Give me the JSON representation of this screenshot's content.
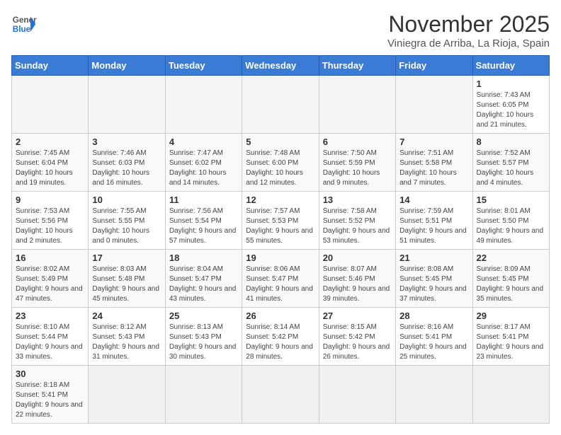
{
  "header": {
    "logo_general": "General",
    "logo_blue": "Blue",
    "month_title": "November 2025",
    "subtitle": "Viniegra de Arriba, La Rioja, Spain"
  },
  "weekdays": [
    "Sunday",
    "Monday",
    "Tuesday",
    "Wednesday",
    "Thursday",
    "Friday",
    "Saturday"
  ],
  "weeks": [
    [
      {
        "day": "",
        "info": ""
      },
      {
        "day": "",
        "info": ""
      },
      {
        "day": "",
        "info": ""
      },
      {
        "day": "",
        "info": ""
      },
      {
        "day": "",
        "info": ""
      },
      {
        "day": "",
        "info": ""
      },
      {
        "day": "1",
        "info": "Sunrise: 7:43 AM\nSunset: 6:05 PM\nDaylight: 10 hours and 21 minutes."
      }
    ],
    [
      {
        "day": "2",
        "info": "Sunrise: 7:45 AM\nSunset: 6:04 PM\nDaylight: 10 hours and 19 minutes."
      },
      {
        "day": "3",
        "info": "Sunrise: 7:46 AM\nSunset: 6:03 PM\nDaylight: 10 hours and 16 minutes."
      },
      {
        "day": "4",
        "info": "Sunrise: 7:47 AM\nSunset: 6:02 PM\nDaylight: 10 hours and 14 minutes."
      },
      {
        "day": "5",
        "info": "Sunrise: 7:48 AM\nSunset: 6:00 PM\nDaylight: 10 hours and 12 minutes."
      },
      {
        "day": "6",
        "info": "Sunrise: 7:50 AM\nSunset: 5:59 PM\nDaylight: 10 hours and 9 minutes."
      },
      {
        "day": "7",
        "info": "Sunrise: 7:51 AM\nSunset: 5:58 PM\nDaylight: 10 hours and 7 minutes."
      },
      {
        "day": "8",
        "info": "Sunrise: 7:52 AM\nSunset: 5:57 PM\nDaylight: 10 hours and 4 minutes."
      }
    ],
    [
      {
        "day": "9",
        "info": "Sunrise: 7:53 AM\nSunset: 5:56 PM\nDaylight: 10 hours and 2 minutes."
      },
      {
        "day": "10",
        "info": "Sunrise: 7:55 AM\nSunset: 5:55 PM\nDaylight: 10 hours and 0 minutes."
      },
      {
        "day": "11",
        "info": "Sunrise: 7:56 AM\nSunset: 5:54 PM\nDaylight: 9 hours and 57 minutes."
      },
      {
        "day": "12",
        "info": "Sunrise: 7:57 AM\nSunset: 5:53 PM\nDaylight: 9 hours and 55 minutes."
      },
      {
        "day": "13",
        "info": "Sunrise: 7:58 AM\nSunset: 5:52 PM\nDaylight: 9 hours and 53 minutes."
      },
      {
        "day": "14",
        "info": "Sunrise: 7:59 AM\nSunset: 5:51 PM\nDaylight: 9 hours and 51 minutes."
      },
      {
        "day": "15",
        "info": "Sunrise: 8:01 AM\nSunset: 5:50 PM\nDaylight: 9 hours and 49 minutes."
      }
    ],
    [
      {
        "day": "16",
        "info": "Sunrise: 8:02 AM\nSunset: 5:49 PM\nDaylight: 9 hours and 47 minutes."
      },
      {
        "day": "17",
        "info": "Sunrise: 8:03 AM\nSunset: 5:48 PM\nDaylight: 9 hours and 45 minutes."
      },
      {
        "day": "18",
        "info": "Sunrise: 8:04 AM\nSunset: 5:47 PM\nDaylight: 9 hours and 43 minutes."
      },
      {
        "day": "19",
        "info": "Sunrise: 8:06 AM\nSunset: 5:47 PM\nDaylight: 9 hours and 41 minutes."
      },
      {
        "day": "20",
        "info": "Sunrise: 8:07 AM\nSunset: 5:46 PM\nDaylight: 9 hours and 39 minutes."
      },
      {
        "day": "21",
        "info": "Sunrise: 8:08 AM\nSunset: 5:45 PM\nDaylight: 9 hours and 37 minutes."
      },
      {
        "day": "22",
        "info": "Sunrise: 8:09 AM\nSunset: 5:45 PM\nDaylight: 9 hours and 35 minutes."
      }
    ],
    [
      {
        "day": "23",
        "info": "Sunrise: 8:10 AM\nSunset: 5:44 PM\nDaylight: 9 hours and 33 minutes."
      },
      {
        "day": "24",
        "info": "Sunrise: 8:12 AM\nSunset: 5:43 PM\nDaylight: 9 hours and 31 minutes."
      },
      {
        "day": "25",
        "info": "Sunrise: 8:13 AM\nSunset: 5:43 PM\nDaylight: 9 hours and 30 minutes."
      },
      {
        "day": "26",
        "info": "Sunrise: 8:14 AM\nSunset: 5:42 PM\nDaylight: 9 hours and 28 minutes."
      },
      {
        "day": "27",
        "info": "Sunrise: 8:15 AM\nSunset: 5:42 PM\nDaylight: 9 hours and 26 minutes."
      },
      {
        "day": "28",
        "info": "Sunrise: 8:16 AM\nSunset: 5:41 PM\nDaylight: 9 hours and 25 minutes."
      },
      {
        "day": "29",
        "info": "Sunrise: 8:17 AM\nSunset: 5:41 PM\nDaylight: 9 hours and 23 minutes."
      }
    ],
    [
      {
        "day": "30",
        "info": "Sunrise: 8:18 AM\nSunset: 5:41 PM\nDaylight: 9 hours and 22 minutes."
      },
      {
        "day": "",
        "info": ""
      },
      {
        "day": "",
        "info": ""
      },
      {
        "day": "",
        "info": ""
      },
      {
        "day": "",
        "info": ""
      },
      {
        "day": "",
        "info": ""
      },
      {
        "day": "",
        "info": ""
      }
    ]
  ]
}
